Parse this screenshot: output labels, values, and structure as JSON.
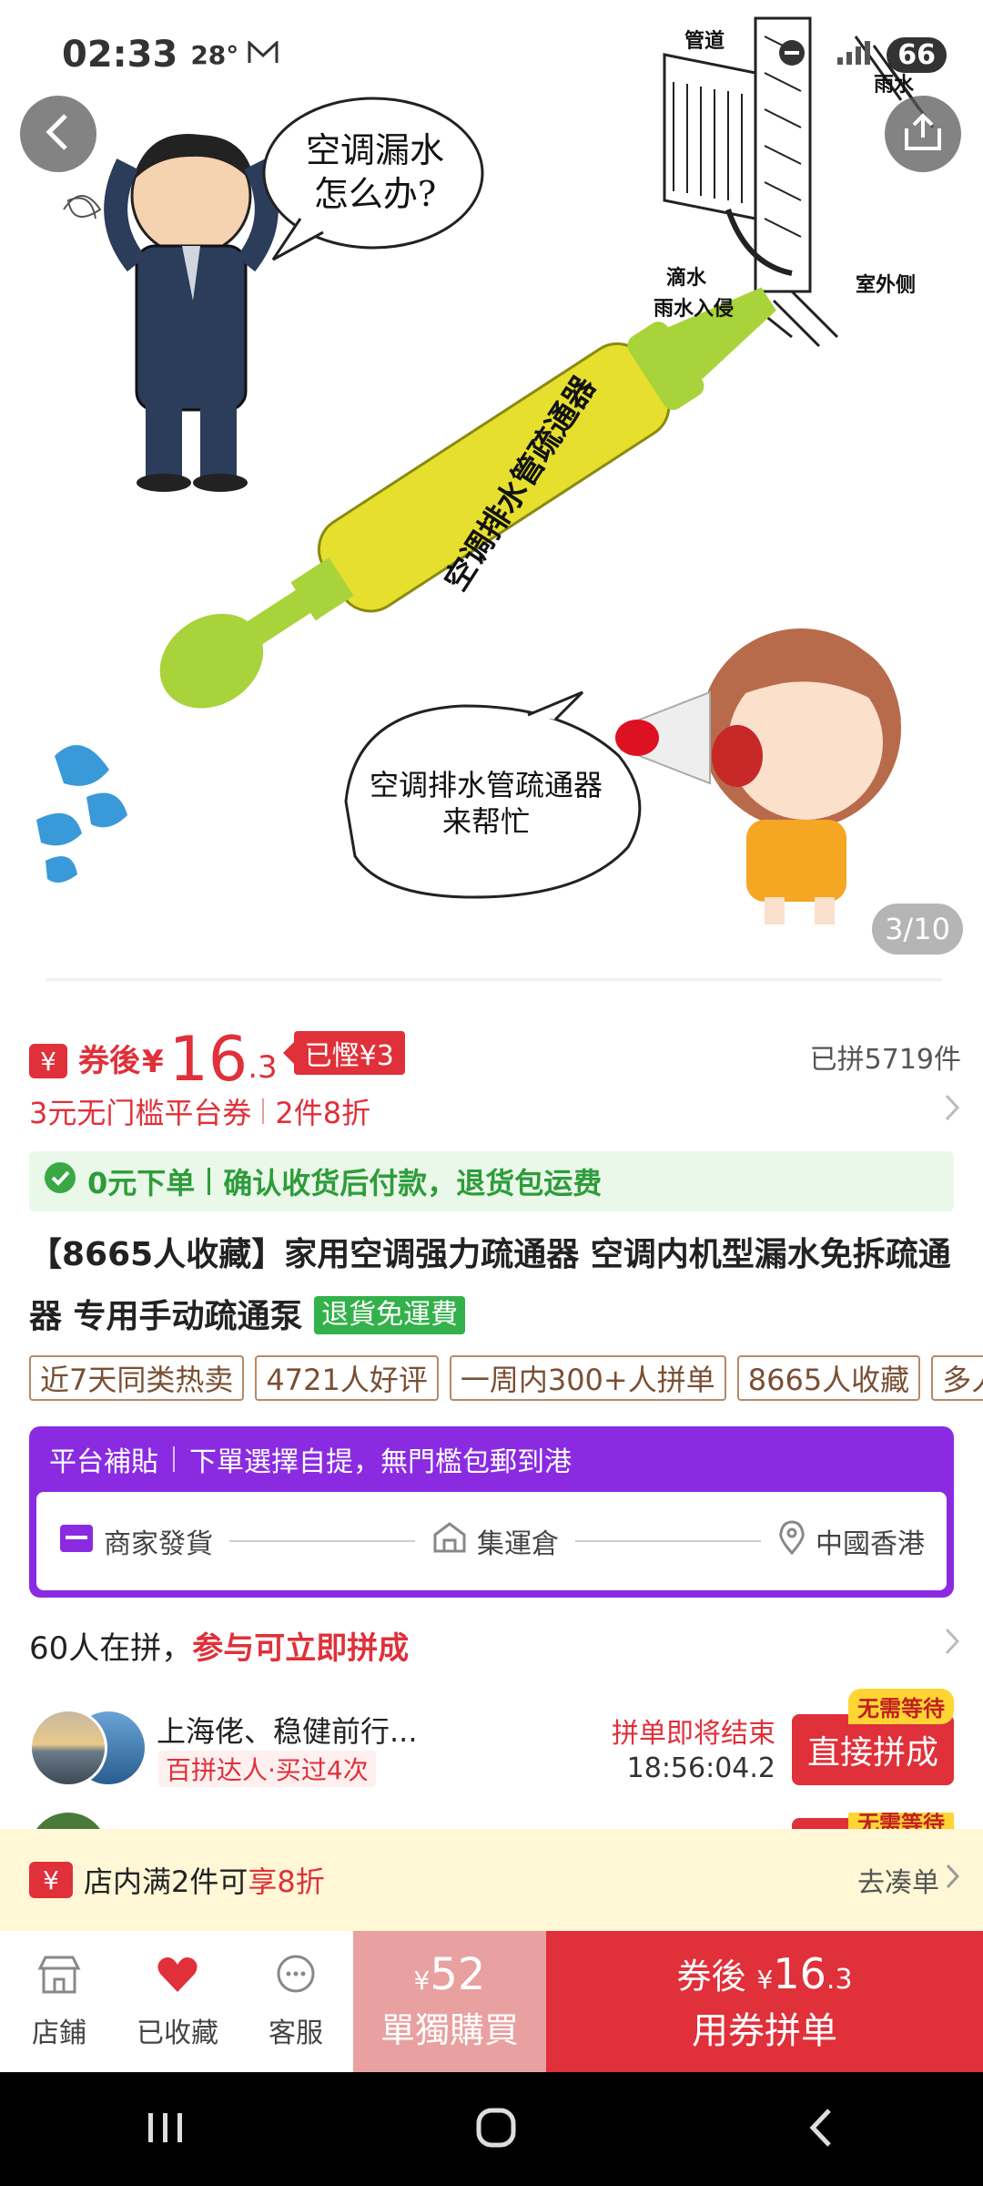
{
  "status_bar": {
    "time": "02:33",
    "temperature": "28°",
    "battery": "66",
    "left_icons": [
      "mail-icon"
    ]
  },
  "gallery": {
    "counter": "3/10",
    "man_bubble": [
      "空调漏水",
      "怎么办?"
    ],
    "girl_bubble": [
      "空调排水管疏通器",
      "来帮忙"
    ],
    "tool_label": "空调排水管疏通器",
    "diagram_labels": {
      "pipe": "管道",
      "rain": "雨水",
      "drip": "滴水",
      "rain_in": "雨水入侵",
      "outside": "室外侧"
    }
  },
  "price": {
    "coupon_icon": "¥",
    "prefix": "券後",
    "currency": "¥",
    "integer": "16",
    "decimal": ".3",
    "saved": "已慳¥3",
    "sold": "已拼5719件"
  },
  "promos": [
    "3元无门槛平台券",
    "2件8折"
  ],
  "guarantee": {
    "left": "0元下单",
    "right": "确认收货后付款，退货包运费"
  },
  "title": {
    "text": "【8665人收藏】家用空调强力疏通器 空调内机型漏水免拆疏通器 专用手动疏通泵",
    "badge": "退貨免運費"
  },
  "tags": [
    "近7天同类热卖",
    "4721人好评",
    "一周内300+人拼单",
    "8665人收藏",
    "多人"
  ],
  "subsidy": {
    "label": "平台補貼",
    "desc": "下單選擇自提，無門檻包郵到港",
    "steps": [
      "商家發貨",
      "集運倉",
      "中國香港"
    ]
  },
  "group": {
    "count_text": "60人在拼，",
    "action_text": "参与可立即拼成",
    "rows": [
      {
        "name": "上海佬、稳健前行...",
        "badge": "百拼达人·买过4次",
        "status": "拼单即将结束",
        "countdown": "18:56:04.2",
        "button": "直接拼成",
        "tag": "无需等待"
      }
    ],
    "row2_tag": "无需等待"
  },
  "shop_discount": {
    "icon": "¥",
    "text": "店内满2件可",
    "highlight": "享8折",
    "link": "去凑单"
  },
  "actions": {
    "shop": "店鋪",
    "favorite": "已收藏",
    "service": "客服",
    "solo_price_currency": "¥",
    "solo_price": "52",
    "solo_label": "單獨購買",
    "group_prefix": "券後",
    "group_currency": "¥",
    "group_price_int": "16",
    "group_price_dec": ".3",
    "group_label": "用券拼单"
  },
  "colors": {
    "accent_red": "#e0303a",
    "purple": "#8a2be2",
    "green": "#33b14a",
    "yellow_bar": "#fff7d6"
  }
}
